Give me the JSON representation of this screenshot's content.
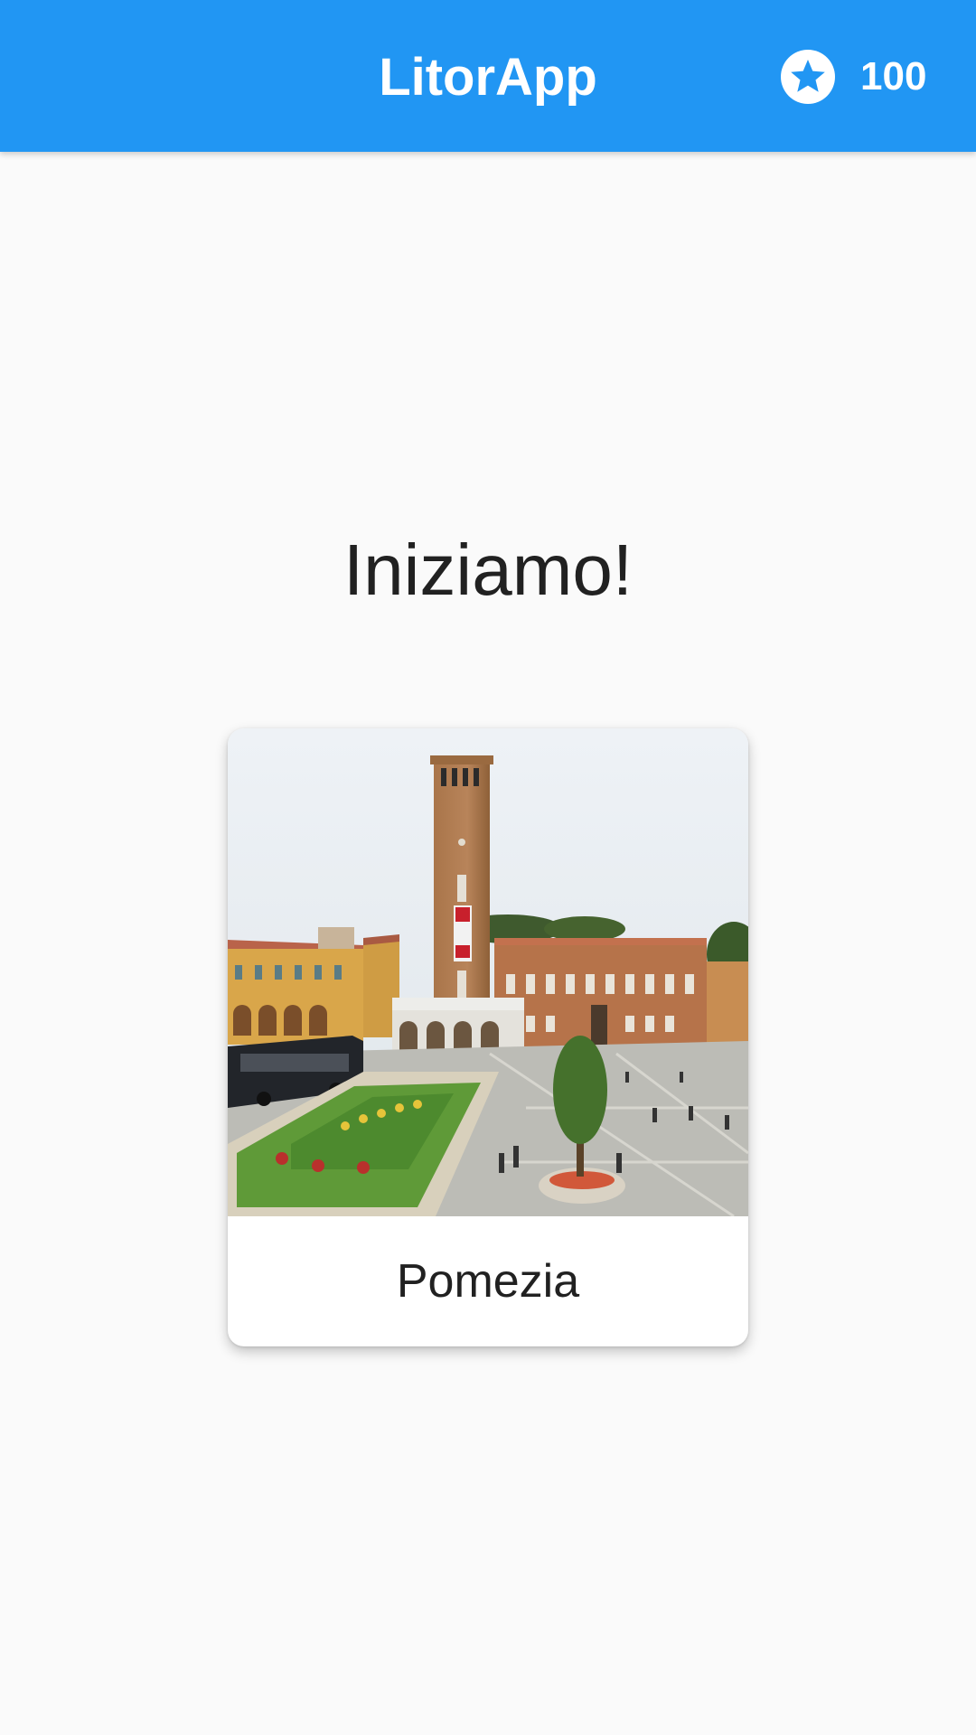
{
  "app_bar": {
    "title": "LitorApp",
    "score_icon": "star-icon",
    "score": "100",
    "color": "#2196f3"
  },
  "main": {
    "heading": "Iniziamo!",
    "card": {
      "image_icon": "town-square-photo",
      "label": "Pomezia"
    }
  }
}
